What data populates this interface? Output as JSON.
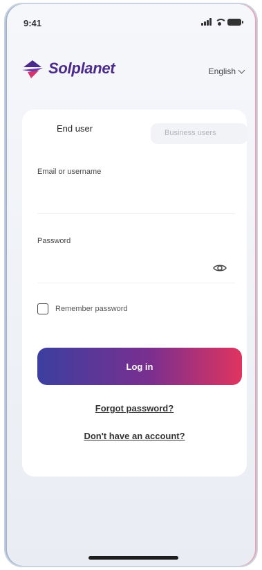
{
  "status_bar": {
    "time": "9:41"
  },
  "header": {
    "brand": "Solplanet",
    "language": "English"
  },
  "tabs": [
    {
      "label": "End user",
      "active": true
    },
    {
      "label": "Business users",
      "active": false
    }
  ],
  "form": {
    "email_label": "Email or username",
    "password_label": "Password",
    "remember_label": "Remember password",
    "remember_checked": false,
    "login_label": "Log in",
    "forgot_link": "Forgot password?",
    "signup_link": "Don't have an account?"
  },
  "colors": {
    "brand_purple": "#4a2a8a",
    "button_start": "#3b3fa0",
    "button_end": "#e0345f"
  },
  "icons": [
    "signal-icon",
    "wifi-icon",
    "battery-icon",
    "solplanet-logo-icon",
    "chevron-down-icon",
    "eye-icon"
  ]
}
